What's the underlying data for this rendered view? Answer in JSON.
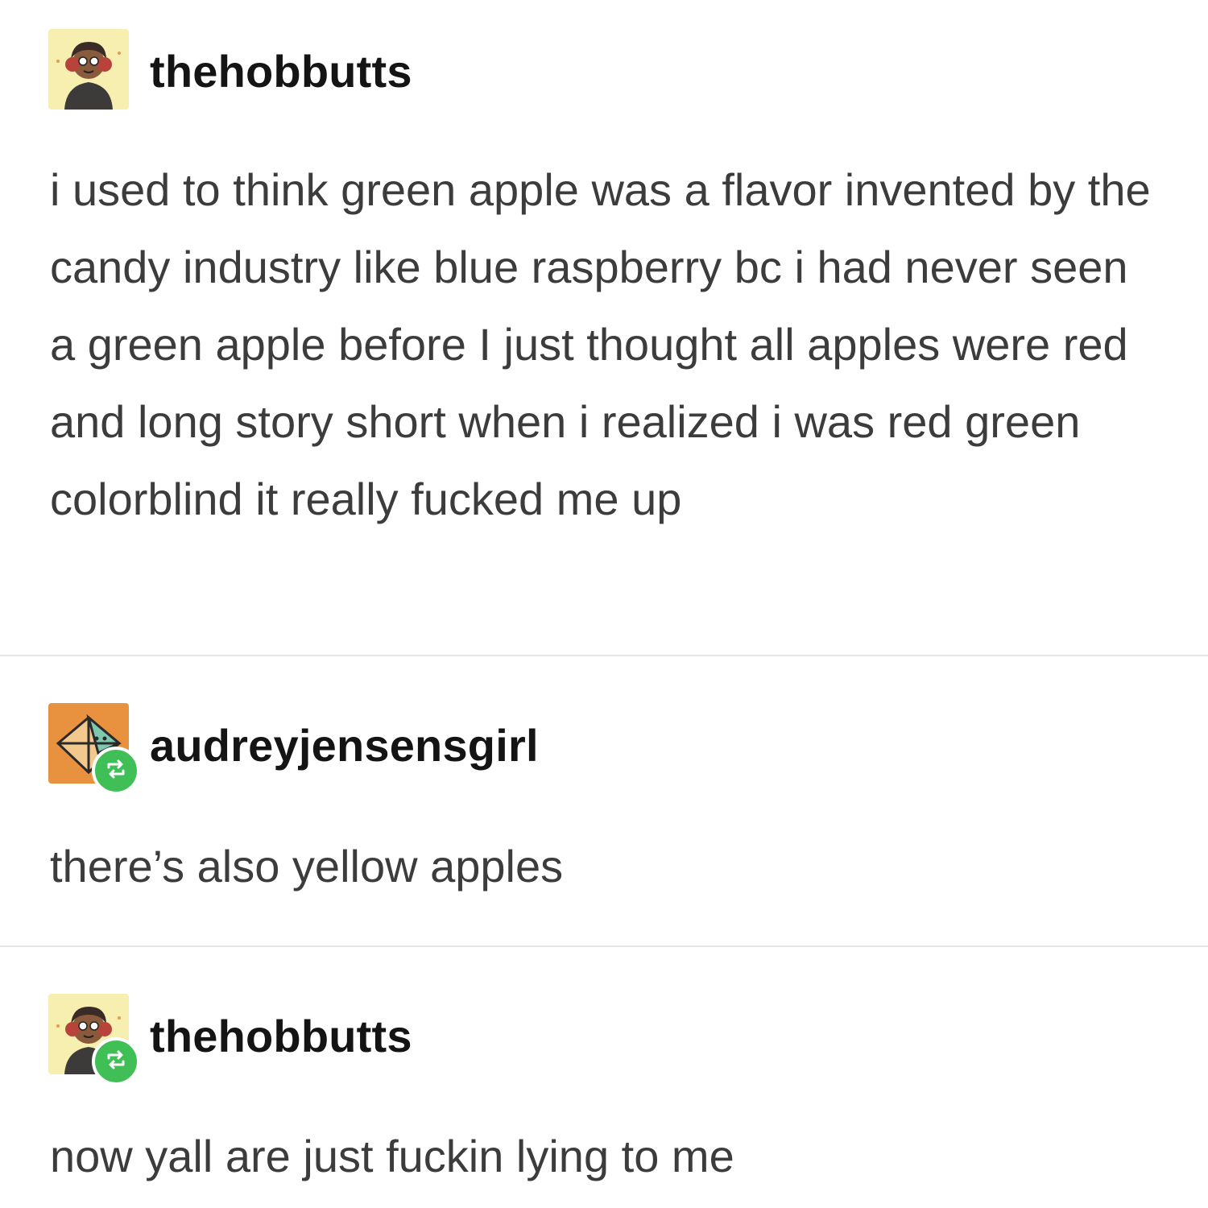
{
  "posts": [
    {
      "username": "thehobbutts",
      "avatar": "thehobbutts-avatar",
      "reblogged": false,
      "body": "i used to think green apple was a flavor invented by the candy industry like blue raspberry bc i had never seen a green apple before I just thought all apples were red and long story short when i realized i was red green colorblind it really fucked me up"
    },
    {
      "username": "audreyjensensgirl",
      "avatar": "audreyjensensgirl-avatar",
      "reblogged": true,
      "body": "there’s also yellow apples"
    },
    {
      "username": "thehobbutts",
      "avatar": "thehobbutts-avatar",
      "reblogged": true,
      "body": "now yall are just fuckin lying to me"
    }
  ],
  "colors": {
    "background": "#ffffff",
    "text": "#3c3c3c",
    "username": "#141414",
    "divider": "#e6e6e6",
    "reblog_badge": "#3fbf55",
    "avatar_yellow_bg": "#f6efb0",
    "avatar_orange_bg": "#e8913e"
  },
  "icons": [
    "reblog-icon"
  ]
}
